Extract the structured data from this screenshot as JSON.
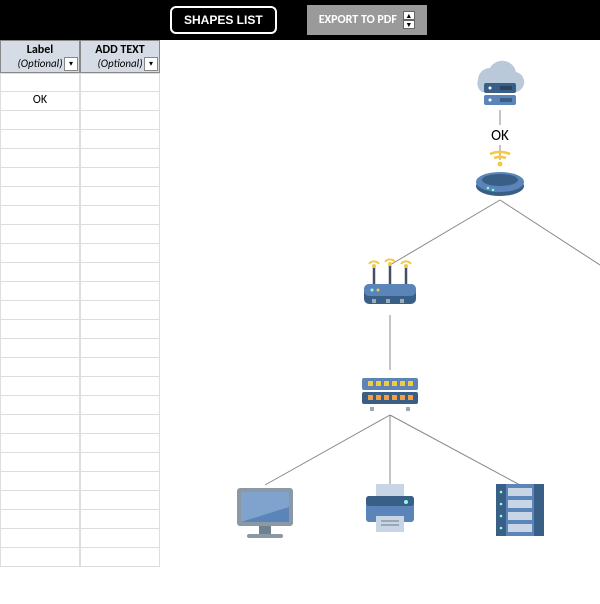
{
  "toolbar": {
    "shapes_list": "SHAPES LIST",
    "export_pdf": "EXPORT  TO PDF"
  },
  "table": {
    "headers": [
      {
        "title": "Label",
        "sub": "(Optional)"
      },
      {
        "title": "ADD TEXT",
        "sub": "(Optional)"
      }
    ],
    "rows": [
      [
        "",
        ""
      ],
      [
        "OK",
        ""
      ],
      [
        "",
        ""
      ],
      [
        "",
        ""
      ],
      [
        "",
        ""
      ],
      [
        "",
        ""
      ],
      [
        "",
        ""
      ],
      [
        "",
        ""
      ],
      [
        "",
        ""
      ],
      [
        "",
        ""
      ],
      [
        "",
        ""
      ],
      [
        "",
        ""
      ],
      [
        "",
        ""
      ],
      [
        "",
        ""
      ],
      [
        "",
        ""
      ],
      [
        "",
        ""
      ],
      [
        "",
        ""
      ],
      [
        "",
        ""
      ],
      [
        "",
        ""
      ],
      [
        "",
        ""
      ],
      [
        "",
        ""
      ],
      [
        "",
        ""
      ],
      [
        "",
        ""
      ],
      [
        "",
        ""
      ],
      [
        "",
        ""
      ],
      [
        "",
        ""
      ]
    ]
  },
  "diagram": {
    "ok_label": "OK",
    "nodes": {
      "cloud": "cloud-server-icon",
      "modem": "modem-icon",
      "router": "router-icon",
      "switch": "switch-icon",
      "monitor": "monitor-icon",
      "printer": "printer-icon",
      "server": "server-icon"
    }
  },
  "colors": {
    "blue1": "#5b85b8",
    "blue2": "#3a5f87",
    "gray": "#8b99a6",
    "light": "#c7d5e4",
    "yellow": "#f5c945",
    "orange": "#f59e45"
  }
}
